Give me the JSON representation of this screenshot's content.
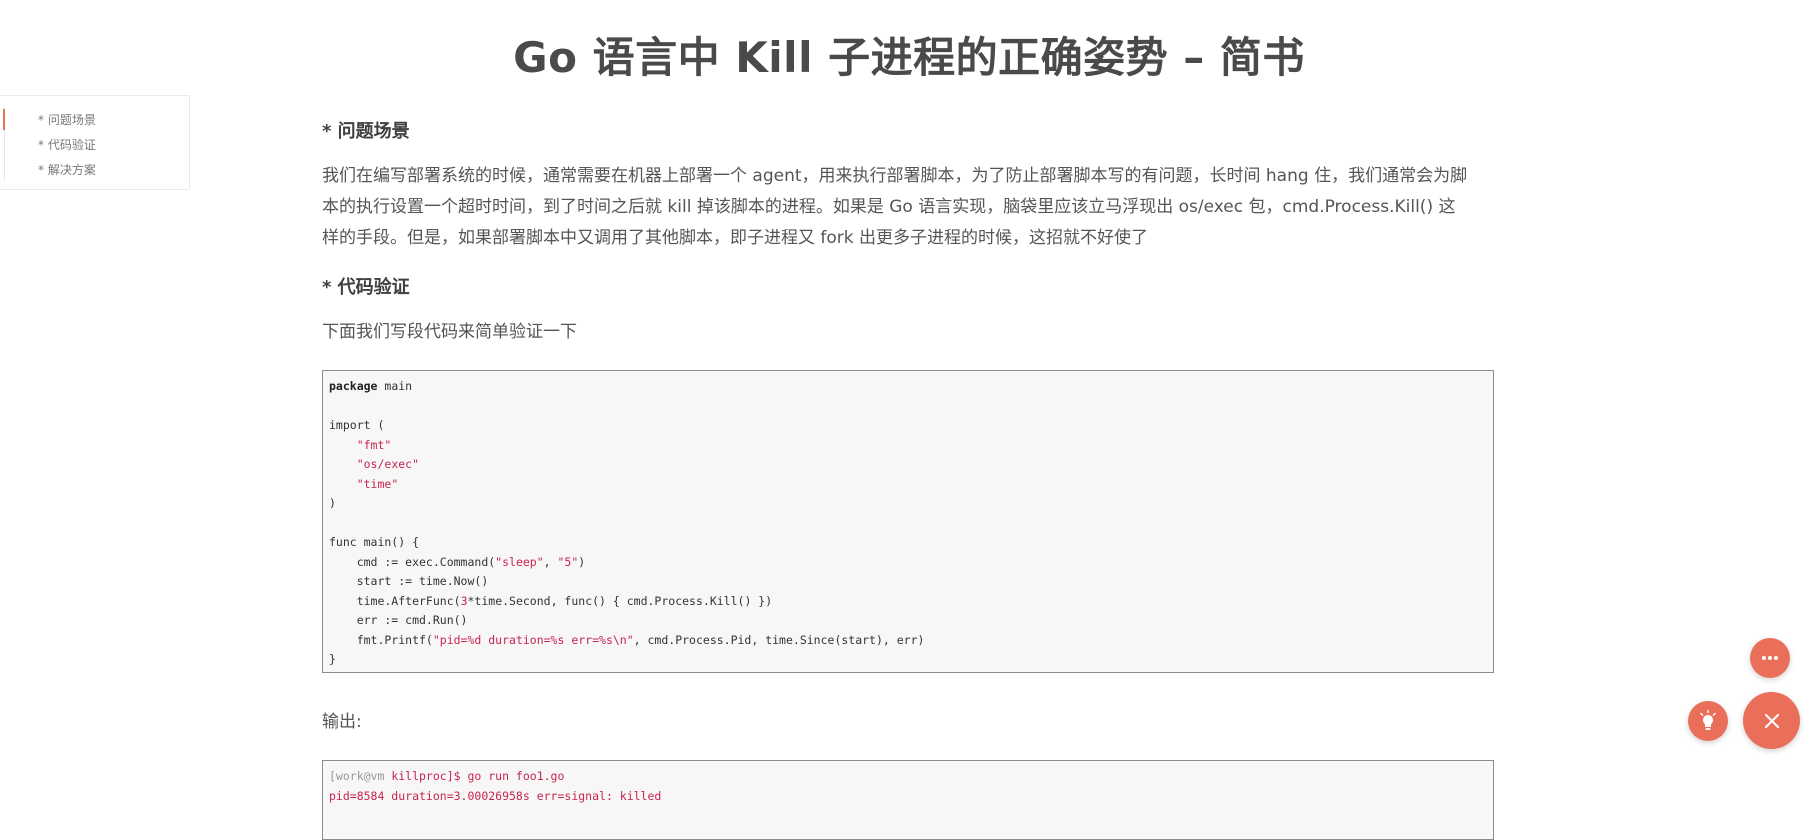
{
  "page": {
    "title": "Go 语言中 Kill 子进程的正确姿势 – 简书"
  },
  "toc": {
    "items": [
      {
        "label": "* 问题场景"
      },
      {
        "label": "* 代码验证"
      },
      {
        "label": "* 解决方案"
      }
    ]
  },
  "article": {
    "section1_heading": "* 问题场景",
    "section1_lines": [
      "我们在编写部署系统的时候，通常需要在机器上部署一个 agent，用来执行部署脚本，为了防止部署脚本写的有问题，长时间 hang 住，我们通常会为脚",
      "本的执行设置一个超时时间，到了时间之后就 kill 掉该脚本的进程。如果是 Go 语言实现，脑袋里应该立马浮现出 os/exec 包，cmd.Process.Kill() 这",
      "样的手段。但是，如果部署脚本中又调用了其他脚本，即子进程又 fork 出更多子进程的时候，这招就不好使了"
    ],
    "section2_heading": "* 代码验证",
    "section2_intro": "下面我们写段代码来简单验证一下",
    "code": {
      "kw_package": "package",
      "package_rest": " main",
      "import_open": "import (",
      "imp_fmt": "\"fmt\"",
      "imp_osexec": "\"os/exec\"",
      "imp_time": "\"time\"",
      "import_close": ")",
      "func_main": "func main() {",
      "l_cmd_a": "    cmd := exec.Command(",
      "l_cmd_s1": "\"sleep\"",
      "l_cmd_b": ", ",
      "l_cmd_s2": "\"5\"",
      "l_cmd_c": ")",
      "l_start": "    start := time.Now()",
      "l_after_a": "    time.AfterFunc(",
      "l_after_num": "3",
      "l_after_b": "*time.Second, func() { cmd.Process.Kill() })",
      "l_err": "    err := cmd.Run()",
      "l_printf_a": "    fmt.Printf(",
      "l_printf_s": "\"pid=%d duration=%s err=%s\\n\"",
      "l_printf_b": ", cmd.Process.Pid, time.Since(start), err)",
      "close_brace": "}"
    },
    "output_label": "输出:",
    "output": {
      "prompt_a": "[work@vm ",
      "prompt_b": "killproc]$ go run foo1.go",
      "line2": "pid=8584 duration=3.00026958s err=signal: killed"
    }
  },
  "fabs": {
    "more_icon": "more-dots-icon",
    "light_icon": "lightbulb-icon",
    "close_icon": "close-icon",
    "accent_color": "#ea6f5a"
  }
}
